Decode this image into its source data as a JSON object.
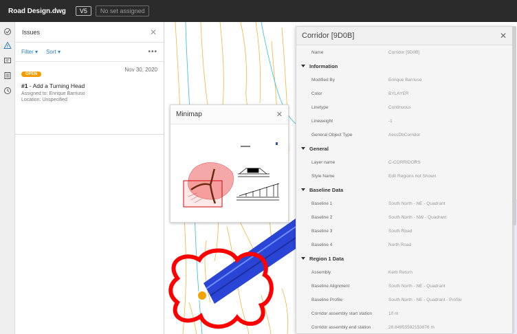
{
  "topbar": {
    "title": "Road Design.dwg",
    "version": "V5",
    "no_set": "No set assigned"
  },
  "rail": {
    "icons": [
      "check-circle-icon",
      "warning-icon",
      "message-icon",
      "list-icon",
      "clock-icon"
    ]
  },
  "issues": {
    "title": "Issues",
    "filter_label": "Filter",
    "sort_label": "Sort",
    "items": [
      {
        "status": "OPEN",
        "date": "Nov 30, 2020",
        "number": "#1",
        "title": "Add a Turning Head",
        "assigned": "Assigned to: Enrique Barriuso",
        "location": "Location: Unspecified"
      }
    ]
  },
  "minimap": {
    "title": "Minimap"
  },
  "props": {
    "title": "Corridor [9D0B]",
    "name_row": {
      "k": "Name",
      "v": "Corridor [9D0B]"
    },
    "sections": [
      {
        "name": "Information",
        "rows": [
          {
            "k": "Modified By",
            "v": "Enrique Barriuso"
          },
          {
            "k": "Color",
            "v": "BYLAYER"
          },
          {
            "k": "Linetype",
            "v": "Continuous"
          },
          {
            "k": "Lineweight",
            "v": "-1"
          },
          {
            "k": "General Object Type",
            "v": "AeccDbCorridor"
          }
        ]
      },
      {
        "name": "General",
        "rows": [
          {
            "k": "Layer name",
            "v": "C-CORRIDORS"
          },
          {
            "k": "Style Name",
            "v": "Edit Regions not Shown"
          }
        ]
      },
      {
        "name": "Baseline Data",
        "rows": [
          {
            "k": "Baseline 1",
            "v": "South North - NE - Quadrant"
          },
          {
            "k": "Baseline 2",
            "v": "South North - NW - Quadrant"
          },
          {
            "k": "Baseline 3",
            "v": "South Road"
          },
          {
            "k": "Baseline 4",
            "v": "North Road"
          }
        ]
      },
      {
        "name": "Region 1 Data",
        "rows": [
          {
            "k": "Assembly",
            "v": "Kerb Return"
          },
          {
            "k": "Baseline Alignment",
            "v": "South North - NE - Quadrant"
          },
          {
            "k": "Baseline Profile",
            "v": "South North - NE - Quadrant - Profile"
          },
          {
            "k": "Corridor assembly start station",
            "v": "10 m"
          },
          {
            "k": "Corridor assembly end station",
            "v": "28.84955592153876 m"
          }
        ]
      }
    ]
  },
  "colors": {
    "accent": "#2a7fbf",
    "open_badge": "#f79b00",
    "contour_orange": "#f0b53c",
    "contour_cyan": "#3ec6d8",
    "corridor_blue": "#2a45d6",
    "markup_red": "#ff0000",
    "pin": "#f2a300"
  }
}
